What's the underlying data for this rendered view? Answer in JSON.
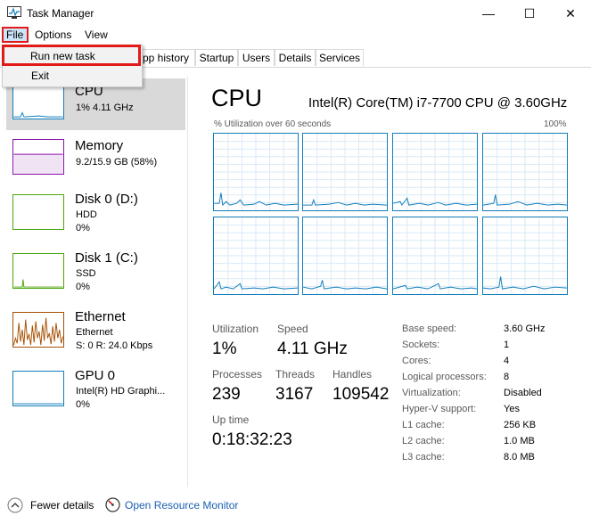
{
  "window": {
    "title": "Task Manager",
    "minimize_glyph": "—",
    "maximize_glyph": "☐",
    "close_glyph": "✕"
  },
  "menubar": {
    "file": "File",
    "options": "Options",
    "view": "View"
  },
  "file_menu": {
    "run_new_task": "Run new task",
    "exit": "Exit"
  },
  "tabs": [
    "pp history",
    "Startup",
    "Users",
    "Details",
    "Services"
  ],
  "sidebar": {
    "cpu": {
      "title": "CPU",
      "sub1": "1%  4.11 GHz"
    },
    "memory": {
      "title": "Memory",
      "sub1": "9.2/15.9 GB (58%)"
    },
    "disk0": {
      "title": "Disk 0 (D:)",
      "sub1": "HDD",
      "sub2": "0%"
    },
    "disk1": {
      "title": "Disk 1 (C:)",
      "sub1": "SSD",
      "sub2": "0%"
    },
    "ethernet": {
      "title": "Ethernet",
      "sub1": "Ethernet",
      "sub2": "S: 0  R: 24.0 Kbps"
    },
    "gpu": {
      "title": "GPU 0",
      "sub1": "Intel(R) HD Graphi...",
      "sub2": "0%"
    }
  },
  "main": {
    "title": "CPU",
    "model": "Intel(R) Core(TM) i7-7700 CPU @ 3.60GHz",
    "graph_label": "% Utilization over 60 seconds",
    "graph_max": "100%",
    "stats": {
      "utilization_label": "Utilization",
      "utilization": "1%",
      "speed_label": "Speed",
      "speed": "4.11 GHz",
      "processes_label": "Processes",
      "processes": "239",
      "threads_label": "Threads",
      "threads": "3167",
      "handles_label": "Handles",
      "handles": "109542",
      "uptime_label": "Up time",
      "uptime": "0:18:32:23"
    },
    "specs": [
      {
        "label": "Base speed:",
        "value": "3.60 GHz"
      },
      {
        "label": "Sockets:",
        "value": "1"
      },
      {
        "label": "Cores:",
        "value": "4"
      },
      {
        "label": "Logical processors:",
        "value": "8"
      },
      {
        "label": "Virtualization:",
        "value": "Disabled"
      },
      {
        "label": "Hyper-V support:",
        "value": "Yes"
      },
      {
        "label": "L1 cache:",
        "value": "256 KB"
      },
      {
        "label": "L2 cache:",
        "value": "1.0 MB"
      },
      {
        "label": "L3 cache:",
        "value": "8.0 MB"
      }
    ]
  },
  "footer": {
    "fewer_details": "Fewer details",
    "open_resource_monitor": "Open Resource Monitor"
  },
  "colors": {
    "cpu": "#117dbb",
    "memory": "#8b12ae",
    "disk": "#4da60c",
    "ethernet": "#a74f01",
    "gpu": "#117dbb",
    "highlight": "#e21a1a"
  },
  "icons": {
    "app": "task-manager-icon",
    "chevron": "chevron-up-icon",
    "monitor": "resource-monitor-icon"
  }
}
